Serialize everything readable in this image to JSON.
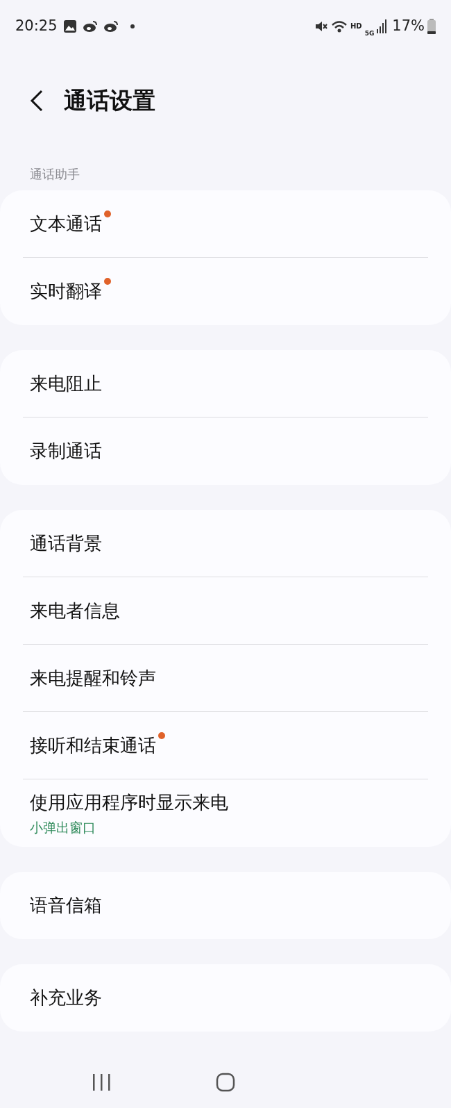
{
  "status_bar": {
    "time": "20:25",
    "network": "HD",
    "cellular": "5G",
    "battery_text": "17%"
  },
  "header": {
    "title": "通话设置"
  },
  "sections": [
    {
      "label": "通话助手",
      "items": [
        {
          "title": "文本通话",
          "new": true
        },
        {
          "title": "实时翻译",
          "new": true
        }
      ]
    },
    {
      "items": [
        {
          "title": "来电阻止",
          "new": false
        },
        {
          "title": "录制通话",
          "new": false
        }
      ]
    },
    {
      "items": [
        {
          "title": "通话背景",
          "new": false
        },
        {
          "title": "来电者信息",
          "new": false
        },
        {
          "title": "来电提醒和铃声",
          "new": false
        },
        {
          "title": "接听和结束通话",
          "new": true
        },
        {
          "title": "使用应用程序时显示来电",
          "subtitle": "小弹出窗口",
          "new": false
        }
      ]
    },
    {
      "items": [
        {
          "title": "语音信箱",
          "new": false
        }
      ]
    },
    {
      "items": [
        {
          "title": "补充业务",
          "new": false
        }
      ]
    }
  ]
}
